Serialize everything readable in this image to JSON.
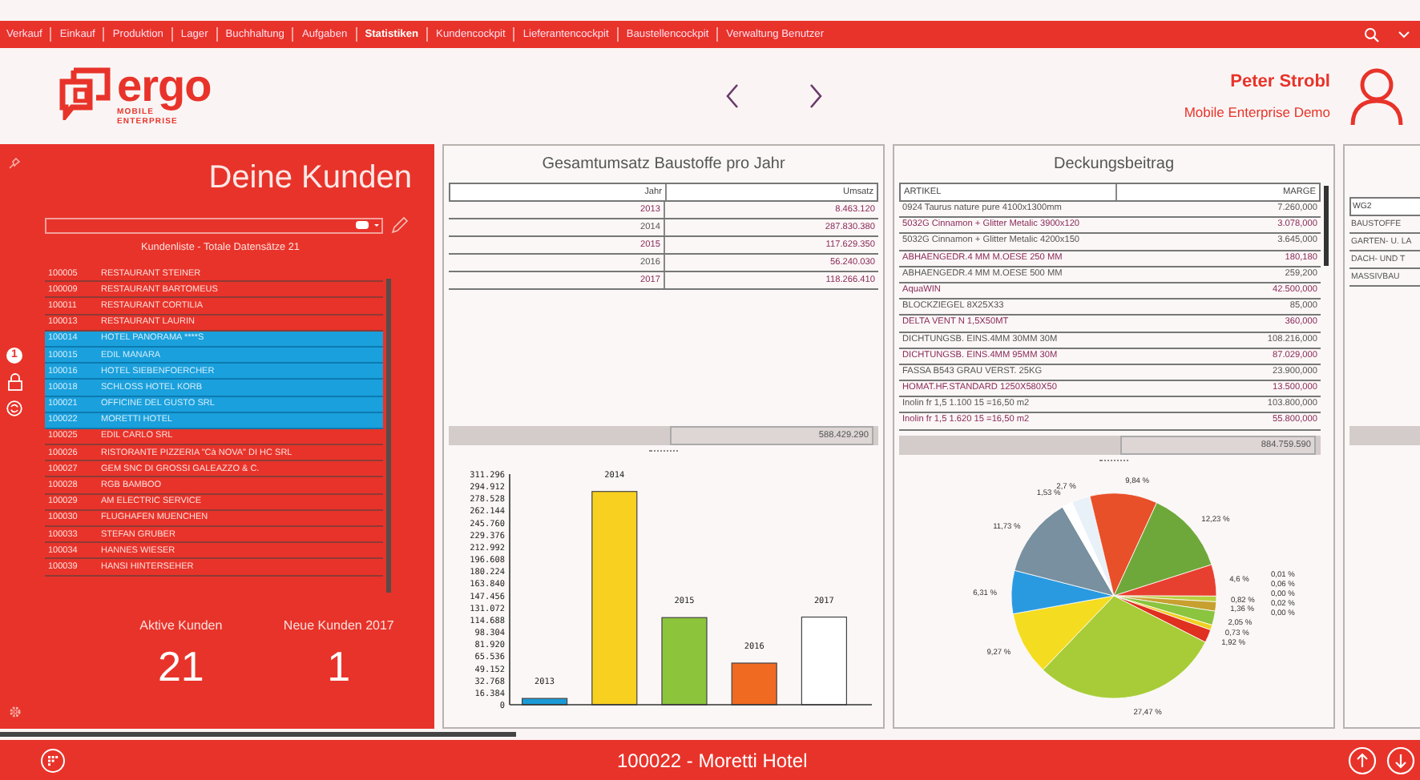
{
  "nav": {
    "items": [
      {
        "label": "Verkauf",
        "selected": false
      },
      {
        "label": "Einkauf",
        "selected": false
      },
      {
        "label": "Produktion",
        "selected": false
      },
      {
        "label": "Lager",
        "selected": false
      },
      {
        "label": "Buchhaltung",
        "selected": false
      },
      {
        "label": "Aufgaben",
        "selected": false
      },
      {
        "label": "Statistiken",
        "selected": true
      },
      {
        "label": "Kundencockpit",
        "selected": false
      },
      {
        "label": "Lieferantencockpit",
        "selected": false
      },
      {
        "label": "Baustellencockpit",
        "selected": false
      },
      {
        "label": "Verwaltung Benutzer",
        "selected": false
      }
    ]
  },
  "header": {
    "logo": {
      "name": "ergo",
      "tagline_1": "MOBILE",
      "tagline_2": "ENTERPRISE"
    },
    "user": {
      "name": "Peter Strobl",
      "role": "Mobile Enterprise Demo"
    }
  },
  "customers": {
    "title": "Deine Kunden",
    "list_caption": "Kundenliste - Totale Datensätze 21",
    "badge": "1",
    "rows": [
      {
        "id": "100005",
        "name": "RESTAURANT STEINER",
        "selected": false
      },
      {
        "id": "100009",
        "name": "RESTAURANT BARTOMEUS",
        "selected": false
      },
      {
        "id": "100011",
        "name": "RESTAURANT CORTILIA",
        "selected": false
      },
      {
        "id": "100013",
        "name": "RESTAURANT LAURIN",
        "selected": false
      },
      {
        "id": "100014",
        "name": "HOTEL PANORAMA ****S",
        "selected": true
      },
      {
        "id": "100015",
        "name": "EDIL MANARA",
        "selected": true
      },
      {
        "id": "100016",
        "name": "HOTEL SIEBENFOERCHER",
        "selected": true
      },
      {
        "id": "100018",
        "name": "SCHLOSS HOTEL KORB",
        "selected": true
      },
      {
        "id": "100021",
        "name": "OFFICINE DEL GUSTO SRL",
        "selected": true
      },
      {
        "id": "100022",
        "name": "MORETTI HOTEL",
        "selected": true
      },
      {
        "id": "100025",
        "name": "EDIL CARLO SRL",
        "selected": false
      },
      {
        "id": "100026",
        "name": "RISTORANTE PIZZERIA \"Cà NOVA\" DI HC SRL",
        "selected": false
      },
      {
        "id": "100027",
        "name": "GEM SNC DI GROSSI GALEAZZO & C.",
        "selected": false
      },
      {
        "id": "100028",
        "name": "RGB BAMBOO",
        "selected": false
      },
      {
        "id": "100029",
        "name": "AM ELECTRIC SERVICE",
        "selected": false
      },
      {
        "id": "100030",
        "name": "FLUGHAFEN MUENCHEN",
        "selected": false
      },
      {
        "id": "100033",
        "name": "STEFAN GRUBER",
        "selected": false
      },
      {
        "id": "100034",
        "name": "HANNES WIESER",
        "selected": false
      },
      {
        "id": "100039",
        "name": "HANSI HINTERSEHER",
        "selected": false
      }
    ],
    "stats": [
      {
        "label": "Aktive Kunden",
        "value": "21"
      },
      {
        "label": "Neue Kunden 2017",
        "value": "1"
      }
    ]
  },
  "revenue": {
    "title": "Gesamtumsatz Baustoffe pro Jahr",
    "columns": [
      "Jahr",
      "Umsatz"
    ],
    "rows": [
      [
        "2013",
        "8.463.120"
      ],
      [
        "2014",
        "287.830.380"
      ],
      [
        "2015",
        "117.629.350"
      ],
      [
        "2016",
        "56.240.030"
      ],
      [
        "2017",
        "118.266.410"
      ]
    ],
    "total": "588.429.290",
    "chart_data": {
      "type": "bar",
      "categories": [
        "2013",
        "2014",
        "2015",
        "2016",
        "2017"
      ],
      "values": [
        8.5,
        287.8,
        117.6,
        56.2,
        118.3
      ],
      "ylim": [
        0,
        311.296
      ],
      "yticks": [
        {
          "value": 0,
          "label": "0"
        },
        {
          "value": 16.384,
          "label": "16.384"
        },
        {
          "value": 32.768,
          "label": "32.768"
        },
        {
          "value": 49.152,
          "label": "49.152"
        },
        {
          "value": 65.536,
          "label": "65.536"
        },
        {
          "value": 81.92,
          "label": "81.920"
        },
        {
          "value": 98.304,
          "label": "98.304"
        },
        {
          "value": 114.688,
          "label": "114.688"
        },
        {
          "value": 131.072,
          "label": "131.072"
        },
        {
          "value": 147.456,
          "label": "147.456"
        },
        {
          "value": 163.84,
          "label": "163.840"
        },
        {
          "value": 180.224,
          "label": "180.224"
        },
        {
          "value": 196.608,
          "label": "196.608"
        },
        {
          "value": 212.992,
          "label": "212.992"
        },
        {
          "value": 229.376,
          "label": "229.376"
        },
        {
          "value": 245.76,
          "label": "245.760"
        },
        {
          "value": 262.144,
          "label": "262.144"
        },
        {
          "value": 278.528,
          "label": "278.528"
        },
        {
          "value": 294.912,
          "label": "294.912"
        },
        {
          "value": 311.296,
          "label": "311.296"
        }
      ]
    }
  },
  "margin": {
    "title": "Deckungsbeitrag",
    "columns": [
      "ARTIKEL",
      "MARGE"
    ],
    "rows": [
      [
        "0924 Taurus nature pure 4100x1300mm",
        "7.260,000"
      ],
      [
        "5032G Cinnamon + Glitter Metalic 3900x120",
        "3.078,000"
      ],
      [
        "5032G Cinnamon + Glitter Metalic 4200x150",
        "3.645,000"
      ],
      [
        "ABHAENGEDR.4 MM M.OESE 250 MM",
        "180,180"
      ],
      [
        "ABHAENGEDR.4 MM M.OESE 500 MM",
        "259,200"
      ],
      [
        "AquaWIN",
        "42.500,000"
      ],
      [
        "BLOCKZIEGEL 8X25X33",
        "85,000"
      ],
      [
        "DELTA VENT N 1,5X50MT",
        "360,000"
      ],
      [
        "DICHTUNGSB. EINS.4MM 30MM 30M",
        "108.216,000"
      ],
      [
        "DICHTUNGSB. EINS.4MM 95MM 30M",
        "87.029,000"
      ],
      [
        "FASSA B543 GRAU VERST. 25KG",
        "23.900,000"
      ],
      [
        "HOMAT.HF.STANDARD 1250X580X50",
        "13.500,000"
      ],
      [
        "Inolin fr 1,5 1.100 15 =16,50 m2",
        "103.800,000"
      ],
      [
        "Inolin fr 1,5 1.620 15 =16,50 m2",
        "55.800,000"
      ]
    ],
    "total": "884.759.590",
    "chart_data": {
      "type": "pie",
      "values": [
        2.7,
        9.84,
        12.23,
        4.6,
        0.82,
        1.36,
        2.05,
        0.73,
        1.92,
        27.47,
        9.27,
        6.31,
        11.73,
        1.53
      ],
      "value_labels": [
        "2,7 %",
        "9,84 %",
        "12,23 %",
        "4,6 %",
        "0,82 %",
        "1,36 %",
        "2,05 %",
        "0,73 %",
        "1,92 %",
        "27,47 %",
        "9,27 %",
        "6,31 %",
        "11,73 %",
        "1,53 %"
      ],
      "annotations": [
        {
          "text": "0,01 %"
        },
        {
          "text": "0,06 %"
        },
        {
          "text": "0,00 %"
        },
        {
          "text": "0,02 %"
        },
        {
          "text": "0,00 %"
        }
      ]
    }
  },
  "groups": {
    "column": "WG2",
    "rows": [
      "BAUSTOFFE",
      "GARTEN- U. LA",
      "DACH- UND T",
      "MASSIVBAU"
    ]
  },
  "footer": {
    "title": "100022 - Moretti Hotel"
  }
}
